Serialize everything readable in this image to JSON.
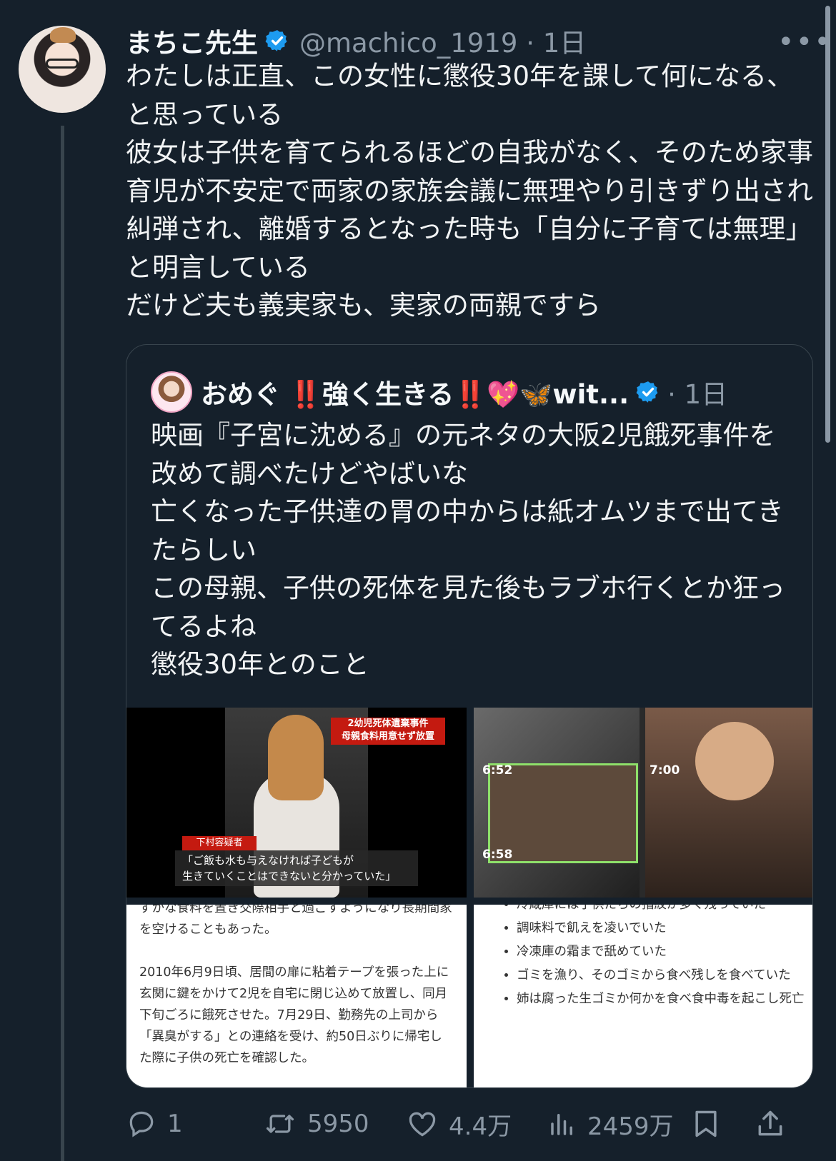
{
  "tweet": {
    "author_name": "まちこ先生",
    "handle_time": "@machico_1919 · 1日",
    "more": "•••",
    "text": "わたしは正直、この女性に懲役30年を課して何になる、と思っている\n彼女は子供を育てられるほどの自我がなく、そのため家事育児が不安定で両家の家族会議に無理やり引きずり出され糾弾され、離婚するとなった時も「自分に子育ては無理」と明言している\nだけど夫も義実家も、実家の両親ですら"
  },
  "quote": {
    "author_name": "おめぐ ‼️強く生きる‼️💖🦋wit...",
    "time": "· 1日",
    "text": "映画『子宮に沈める』の元ネタの大阪2児餓死事件を改めて調べたけどやばいな\n亡くなった子供達の胃の中からは紙オムツまで出てきたらしい\nこの母親、子供の死体を見た後もラブホ行くとか狂ってるよね\n懲役30年とのこと",
    "media": {
      "img1": {
        "red_caption": "2幼児死体遺棄事件\n母親食料用意せず放置",
        "name_caption": "下村容疑者",
        "quote_caption": "「ご飯も水も与えなければ子どもが\n生きていくことはできないと分かっていた」"
      },
      "img2": {
        "time1": "6:52",
        "time2": "6:58",
        "time3": "7:00"
      },
      "img3": {
        "text": "ずかな食料を置き交際相手と過ごすようになり長期間家を空けることもあった。\n\n2010年6月9日頃、居間の扉に粘着テープを張った上に玄関に鍵をかけて2児を自宅に閉じ込めて放置し、同月下旬ごろに餓死させた。7月29日、勤務先の上司から「異臭がする」との連絡を受け、約50日ぶりに帰宅した際に子供の死亡を確認した。"
      },
      "img4": {
        "bullets": [
          "冷蔵庫には子供たちの指紋が多く残っていた",
          "調味料で飢えを凌いでいた",
          "冷凍庫の霜まで舐めていた",
          "ゴミを漁り、そのゴミから食べ残しを食べていた",
          "姉は腐った生ゴミか何かを食べ食中毒を起こし死亡"
        ]
      }
    }
  },
  "actions": {
    "replies": "1",
    "retweets": "5950",
    "likes": "4.4万",
    "views": "2459万"
  },
  "colors": {
    "background": "#15202b",
    "verified": "#1d9bf0",
    "secondary_text": "#8b98a5"
  }
}
